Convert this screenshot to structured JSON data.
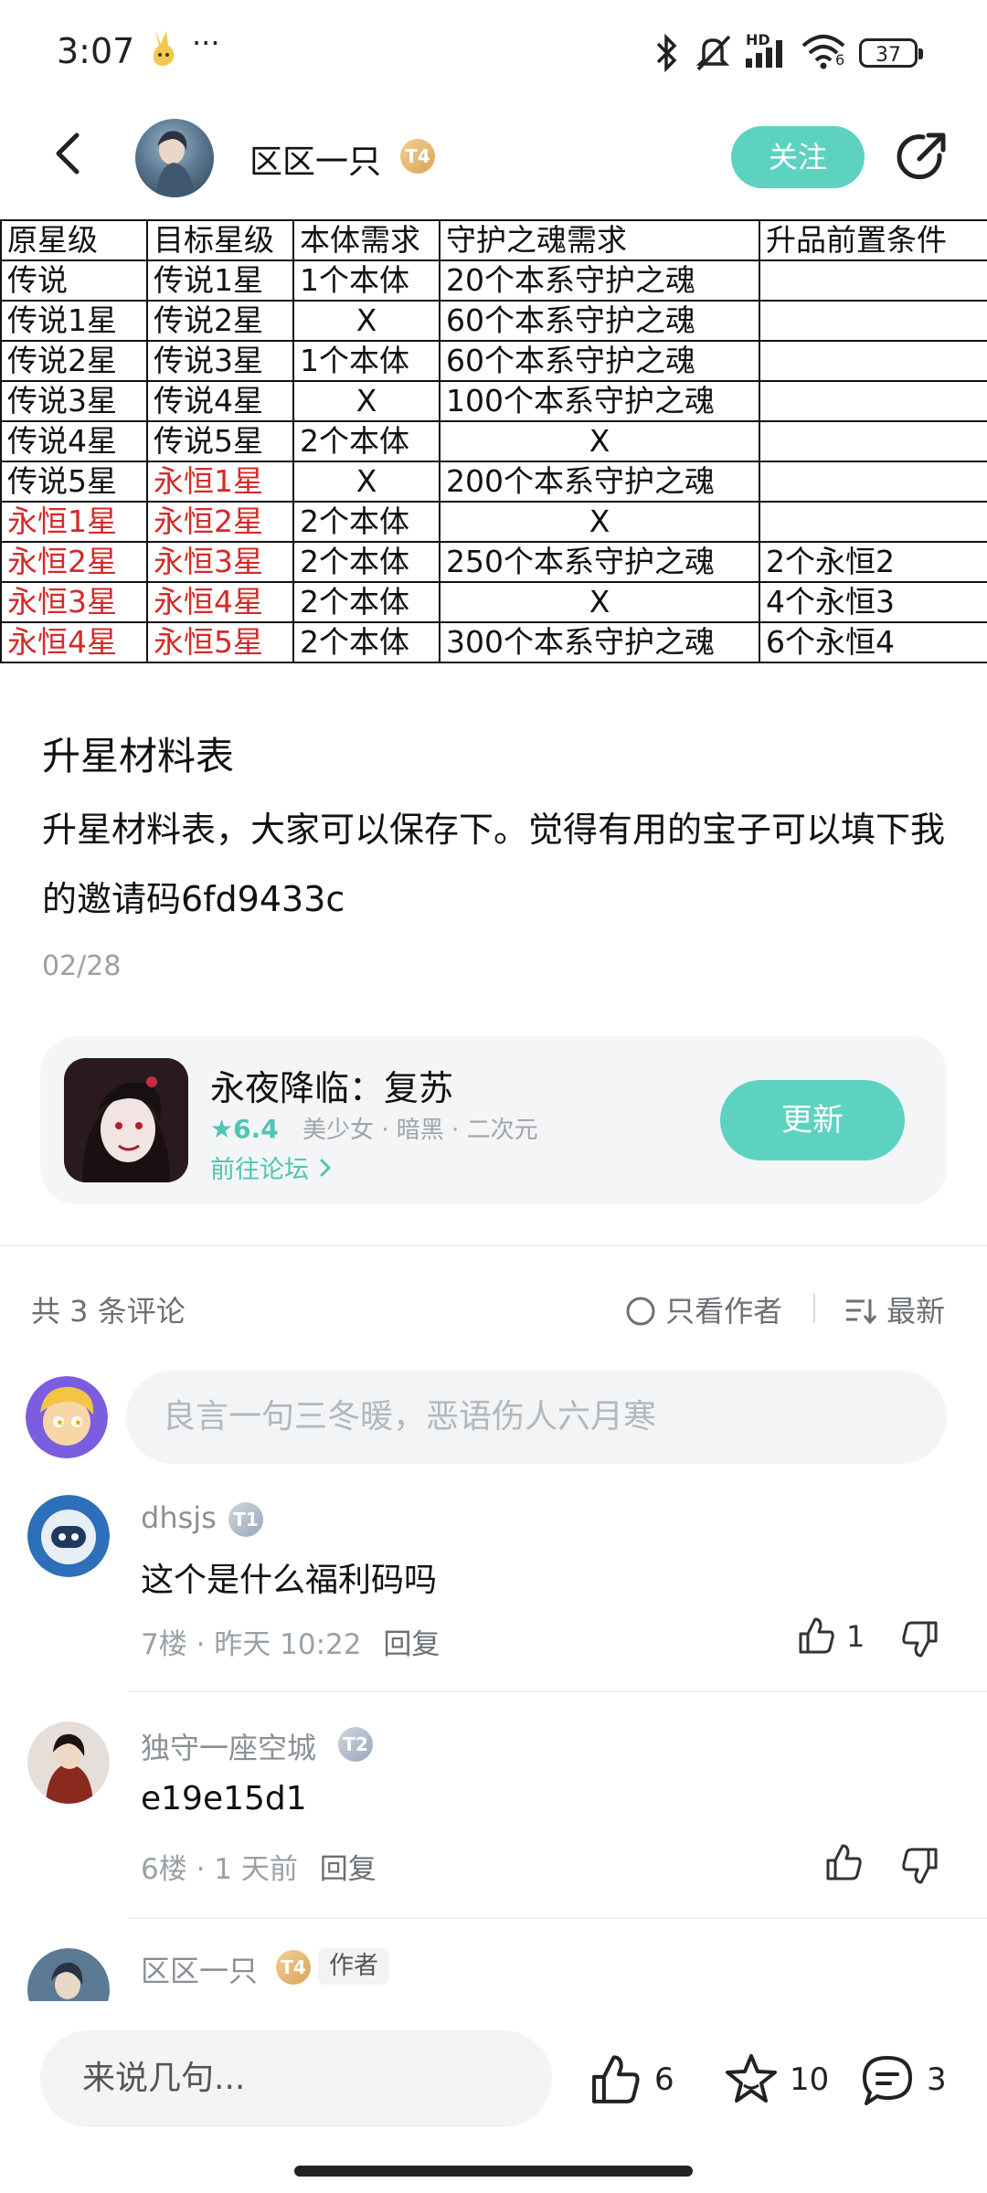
{
  "status_bar": {
    "time": "3:07",
    "dots": "···",
    "network": "HD",
    "wifi_sub": "6",
    "battery": "37"
  },
  "header": {
    "author_name": "区区一只",
    "author_level": "T4",
    "follow_label": "关注"
  },
  "table": {
    "headers": [
      "原星级",
      "目标星级",
      "本体需求",
      "守护之魂需求",
      "升品前置条件"
    ],
    "rows": [
      [
        "传说",
        "传说1星",
        "1个本体",
        "20个本系守护之魂",
        ""
      ],
      [
        "传说1星",
        "传说2星",
        "X",
        "60个本系守护之魂",
        ""
      ],
      [
        "传说2星",
        "传说3星",
        "1个本体",
        "60个本系守护之魂",
        ""
      ],
      [
        "传说3星",
        "传说4星",
        "X",
        "100个本系守护之魂",
        ""
      ],
      [
        "传说4星",
        "传说5星",
        "2个本体",
        "X",
        ""
      ],
      [
        "传说5星",
        "永恒1星",
        "X",
        "200个本系守护之魂",
        ""
      ],
      [
        "永恒1星",
        "永恒2星",
        "2个本体",
        "X",
        ""
      ],
      [
        "永恒2星",
        "永恒3星",
        "2个本体",
        "250个本系守护之魂",
        "2个永恒2"
      ],
      [
        "永恒3星",
        "永恒4星",
        "2个本体",
        "X",
        "4个永恒3"
      ],
      [
        "永恒4星",
        "永恒5星",
        "2个本体",
        "300个本系守护之魂",
        "6个永恒4"
      ]
    ]
  },
  "post": {
    "title": "升星材料表",
    "body": "升星材料表，大家可以保存下。觉得有用的宝子可以填下我的邀请码6fd9433c",
    "date": "02/28"
  },
  "game_card": {
    "name": "永夜降临：复苏",
    "score": "6.4",
    "tags": "美少女 · 暗黑 · 二次元",
    "forum_link": "前往论坛",
    "update_label": "更新"
  },
  "comments_header": {
    "count_label": "共 3 条评论",
    "only_author_label": "只看作者",
    "sort_label": "最新"
  },
  "comment_input": {
    "placeholder": "良言一句三冬暖，恶语伤人六月寒"
  },
  "comments": [
    {
      "user": "dhsjs",
      "level": "T1",
      "text": "这个是什么福利码吗",
      "floor_time": "7楼 · 昨天 10:22",
      "reply_label": "回复",
      "likes": "1"
    },
    {
      "user": "独守一座空城",
      "level": "T2",
      "text": "e19e15d1",
      "floor_time": "6楼 · 1 天前",
      "reply_label": "回复",
      "likes": ""
    },
    {
      "user": "区区一只",
      "level": "T4",
      "tag": "作者"
    }
  ],
  "bottom_bar": {
    "input_placeholder": "来说几句...",
    "likes": "6",
    "favorites": "10",
    "comments": "3"
  },
  "colors": {
    "accent": "#5ed2c0",
    "red_text": "#d42a2a",
    "muted": "#9aa0a6"
  }
}
